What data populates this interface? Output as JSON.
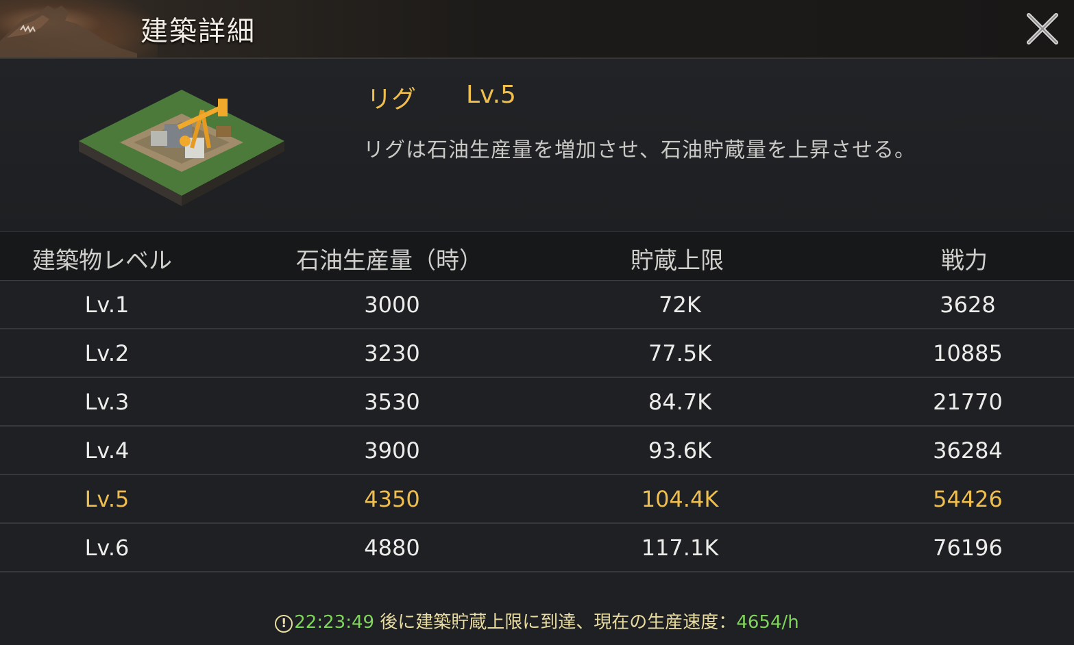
{
  "window": {
    "title": "建築詳細"
  },
  "building": {
    "name": "リグ",
    "level": "Lv.5",
    "description": "リグは石油生産量を増加させ、石油貯蔵量を上昇させる。"
  },
  "table": {
    "headers": [
      "建築物レベル",
      "石油生産量（時）",
      "貯蔵上限",
      "戦力"
    ],
    "rows": [
      {
        "level": "Lv.1",
        "production": "3000",
        "storage": "72K",
        "power": "3628"
      },
      {
        "level": "Lv.2",
        "production": "3230",
        "storage": "77.5K",
        "power": "10885"
      },
      {
        "level": "Lv.3",
        "production": "3530",
        "storage": "84.7K",
        "power": "21770"
      },
      {
        "level": "Lv.4",
        "production": "3900",
        "storage": "93.6K",
        "power": "36284"
      },
      {
        "level": "Lv.5",
        "production": "4350",
        "storage": "104.4K",
        "power": "54426"
      },
      {
        "level": "Lv.6",
        "production": "4880",
        "storage": "117.1K",
        "power": "76196"
      }
    ],
    "current_row_index": 4
  },
  "footer": {
    "warning_icon": "!",
    "time": "22:23:49",
    "message": " 後に建築貯蔵上限に到達、現在の生産速度：",
    "rate": "4654/h"
  },
  "colors": {
    "accent": "#efbe4d",
    "positive": "#7ed55a"
  }
}
